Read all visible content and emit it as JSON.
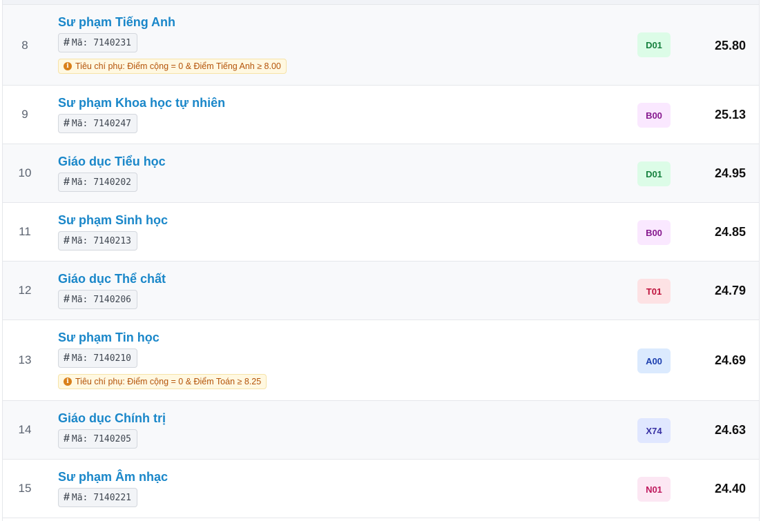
{
  "rows": [
    {
      "rank": "8",
      "name": "Sư phạm Tiếng Anh",
      "code_prefix": "Mã:",
      "code": "7140231",
      "criteria": "Tiêu chí phụ: Điểm cộng = 0 & Điểm Tiếng Anh ≥ 8.00",
      "combo": "D01",
      "combo_bg": "#dcfce7",
      "combo_fg": "#15803d",
      "score": "25.80"
    },
    {
      "rank": "9",
      "name": "Sư phạm Khoa học tự nhiên",
      "code_prefix": "Mã:",
      "code": "7140247",
      "combo": "B00",
      "combo_bg": "#fae8ff",
      "combo_fg": "#86198f",
      "score": "25.13"
    },
    {
      "rank": "10",
      "name": "Giáo dục Tiểu học",
      "code_prefix": "Mã:",
      "code": "7140202",
      "combo": "D01",
      "combo_bg": "#dcfce7",
      "combo_fg": "#15803d",
      "score": "24.95"
    },
    {
      "rank": "11",
      "name": "Sư phạm Sinh học",
      "code_prefix": "Mã:",
      "code": "7140213",
      "combo": "B00",
      "combo_bg": "#fae8ff",
      "combo_fg": "#86198f",
      "score": "24.85"
    },
    {
      "rank": "12",
      "name": "Giáo dục Thể chất",
      "code_prefix": "Mã:",
      "code": "7140206",
      "combo": "T01",
      "combo_bg": "#fde2e4",
      "combo_fg": "#be123c",
      "score": "24.79"
    },
    {
      "rank": "13",
      "name": "Sư phạm Tin học",
      "code_prefix": "Mã:",
      "code": "7140210",
      "criteria": "Tiêu chí phụ: Điểm cộng = 0 & Điểm Toán ≥ 8.25",
      "combo": "A00",
      "combo_bg": "#dbeafe",
      "combo_fg": "#1e40af",
      "score": "24.69"
    },
    {
      "rank": "14",
      "name": "Giáo dục Chính trị",
      "code_prefix": "Mã:",
      "code": "7140205",
      "combo": "X74",
      "combo_bg": "#e0e7ff",
      "combo_fg": "#3730a3",
      "score": "24.63"
    },
    {
      "rank": "15",
      "name": "Sư phạm Âm nhạc",
      "code_prefix": "Mã:",
      "code": "7140221",
      "combo": "N01",
      "combo_bg": "#fce7f3",
      "combo_fg": "#be185d",
      "score": "24.40"
    }
  ],
  "icons": {
    "hash": "#",
    "info": "i"
  }
}
